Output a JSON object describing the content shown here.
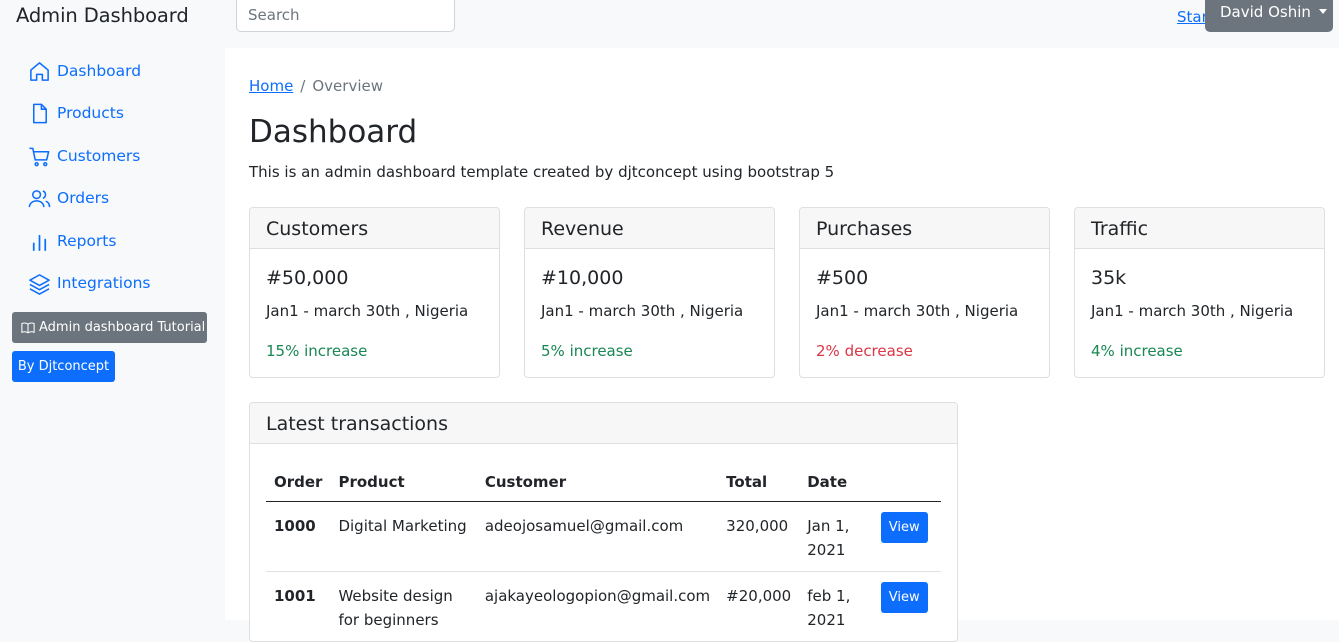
{
  "navbar": {
    "brand": "Admin Dashboard",
    "search_placeholder": "Search",
    "link_partial": "Start",
    "user": "David Oshin"
  },
  "sidebar": {
    "items": [
      {
        "label": "Dashboard",
        "icon": "house-icon"
      },
      {
        "label": "Products",
        "icon": "file-icon"
      },
      {
        "label": "Customers",
        "icon": "cart-icon"
      },
      {
        "label": "Orders",
        "icon": "users-icon"
      },
      {
        "label": "Reports",
        "icon": "bar-chart-icon"
      },
      {
        "label": "Integrations",
        "icon": "layers-icon"
      }
    ],
    "tutorial_button": "Admin dashboard Tutorial",
    "tutorial_icon": "book-icon",
    "credit_button": "By Djtconcept"
  },
  "main": {
    "breadcrumb": {
      "home": "Home",
      "separator": "/",
      "current": "Overview"
    },
    "title": "Dashboard",
    "subtitle": "This is an admin dashboard template created by djtconcept using bootstrap 5",
    "cards": [
      {
        "title": "Customers",
        "value": "#50,000",
        "range": "Jan1 - march 30th , Nigeria",
        "change": "15% increase",
        "trend": "up"
      },
      {
        "title": "Revenue",
        "value": "#10,000",
        "range": "Jan1 - march 30th , Nigeria",
        "change": "5% increase",
        "trend": "up"
      },
      {
        "title": "Purchases",
        "value": "#500",
        "range": "Jan1 - march 30th , Nigeria",
        "change": "2% decrease",
        "trend": "down"
      },
      {
        "title": "Traffic",
        "value": "35k",
        "range": "Jan1 - march 30th , Nigeria",
        "change": "4% increase",
        "trend": "up"
      }
    ],
    "transactions": {
      "title": "Latest transactions",
      "columns": [
        "Order",
        "Product",
        "Customer",
        "Total",
        "Date"
      ],
      "rows": [
        {
          "order": "1000",
          "product": "Digital Marketing",
          "customer": "adeojosamuel@gmail.com",
          "total": "320,000",
          "date": "Jan 1, 2021",
          "action": "View"
        },
        {
          "order": "1001",
          "product": "Website design for beginners",
          "customer": "ajakayeologopion@gmail.com",
          "total": "#20,000",
          "date": "feb 1, 2021",
          "action": "View"
        }
      ]
    }
  },
  "colors": {
    "primary": "#0d6efd",
    "secondary": "#6c757d",
    "success": "#198754",
    "danger": "#dc3545"
  }
}
